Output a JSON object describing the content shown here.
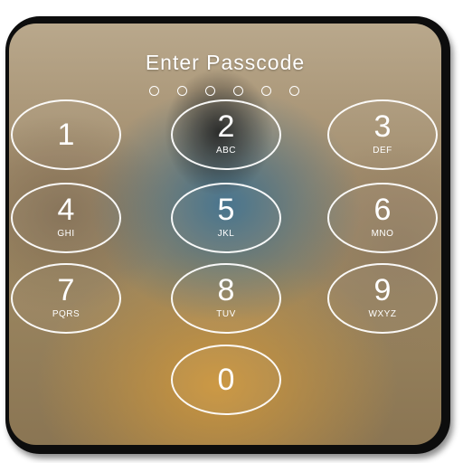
{
  "lock_screen": {
    "title": "Enter Passcode",
    "passcode_length": 6,
    "keys": [
      {
        "digit": "1",
        "letters": ""
      },
      {
        "digit": "2",
        "letters": "ABC"
      },
      {
        "digit": "3",
        "letters": "DEF"
      },
      {
        "digit": "4",
        "letters": "GHI"
      },
      {
        "digit": "5",
        "letters": "JKL"
      },
      {
        "digit": "6",
        "letters": "MNO"
      },
      {
        "digit": "7",
        "letters": "PQRS"
      },
      {
        "digit": "8",
        "letters": "TUV"
      },
      {
        "digit": "9",
        "letters": "WXYZ"
      },
      {
        "digit": "0",
        "letters": ""
      }
    ]
  },
  "colors": {
    "frame": "#0d0d0d",
    "key_outline": "#ffffff",
    "text": "#ffffff"
  }
}
